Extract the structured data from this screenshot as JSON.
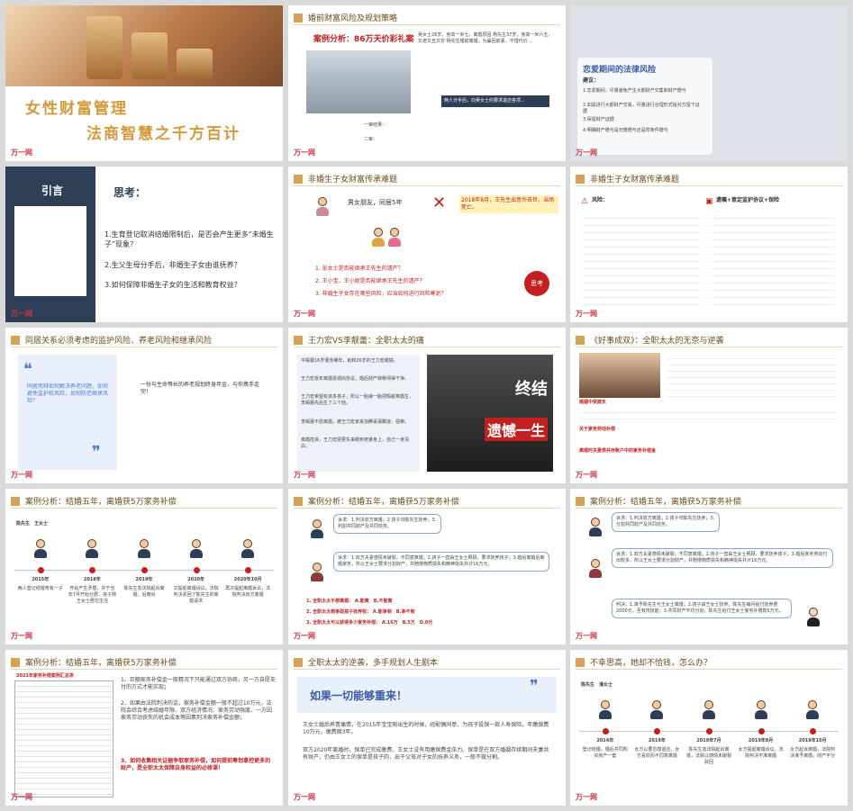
{
  "slides": {
    "s1": {
      "title_line1": "女性财富管理",
      "title_line2": "法商智慧之千方百计",
      "logo": "万一网"
    },
    "s2": {
      "header": "婚前财富风险及规划策略",
      "case_title": "案例分析：86万天价彩礼案",
      "text": "吴女士26岁，身高一米七，离婚原因 杨先生37岁，身高一米六五，又老又丑又穷 杨先生婚前离婚，为赢回前妻，不惜代价…",
      "panel": "两人分手后，向吴女士的要求退还各项…",
      "footer1": "一审结果：",
      "footer2": "二审：",
      "logo": "万一网"
    },
    "s3": {
      "title": "恋爱期间的法律风险",
      "lead": "建议：",
      "item1": "1.恋爱期间，尽量避免产生大额财产交集和财产赠与",
      "item2": "2.如需进行大额财产交易，尽量进行合理形式给对方留下证据",
      "item3": "3.保留财产证据",
      "item4": "4.明确财产赠与是无偿赠与还是附条件赠与",
      "logo": "万一网"
    },
    "s4": {
      "left_title": "引言",
      "right_title": "思考：",
      "q1": "1.生育登记取消结婚限制后，是否会产生更多“未婚生子”现象？",
      "q2": "2.生父生母分手后，非婚生子女由谁抚养？",
      "q3": "3.如何保障非婚生子女的生活和教育权益？",
      "logo": "万一网"
    },
    "s5": {
      "header": "非婚生子女财富传承难题",
      "relation": "男女朋友，同居5年",
      "note": "2018年8月，王先生出意外去世，当场死亡。",
      "q1": "1. 张女士是否能继承王先生的遗产？",
      "q2": "2. 王小宝、王小妮是否能继承王先生的遗产？",
      "q3": "3. 非婚生子女存在哪些风险，应当如何进行风险筹划？",
      "think": "思考",
      "logo": "万一网"
    },
    "s6": {
      "header": "非婚生子女财富传承难题",
      "left_title": "风险：",
      "right_title": "遗嘱+意定监护协议+保险",
      "logo": "万一网"
    },
    "s7": {
      "header": "同居关系必须考虑的监护风险、养老风险和继承风险",
      "left_text": "同居而辩如何解决养老问题，如何避免监护权风险，如何防范继承风险？",
      "right_text": "一份与生命等长的养老规划终身年金，与你携手走完！",
      "logo": "万一网"
    },
    "s8": {
      "header": "王力宏VS李靓蕾：全职太太的痛",
      "b1": "平殿蕾16岁便赤裸年，就和26岁的王力宏眼镜。",
      "b2": "王力宏逐年离婚逐城尚协议，婚后财产转移师得干净。",
      "b3": "王力宏希望有孩多孩子，所以一胎接一胎把瑕疵离婚生，李殿蕾先后生了三个娃。",
      "b4": "李殿蕾不愿离婚，被王力宏家来加腾毒语霸凌，强窜。",
      "b5": "离婚控诉，王力宏把更东来眼到老婆身上，自己一身清白。",
      "poster1": "终结",
      "poster2": "遗憾一生",
      "logo": "万一网"
    },
    "s9": {
      "header": "《好事成双》：全职太太的无奈与逆袭",
      "section1": "婚姻中受欺负",
      "section2": "关于家务劳动补偿",
      "section3": "离婚时夫妻债共存账户中的家务补偿金",
      "logo": "万一网"
    },
    "s10": {
      "header": "案例分析：结婚五年，离婚获5万家务补偿",
      "names": "陈先生　王女士",
      "years": [
        "2015年",
        "2018年",
        "2019年",
        "2020年",
        "2020年10月"
      ],
      "events": [
        "两人登记结婚育有一子",
        "开始产生矛盾，并于当年7月开始分居，孩子随王女士居住生活",
        "陈先生向法院起诉离婚，后撤诉",
        "又提起离婚诉讼，法院判决驳回了陈先生的离婚请求",
        "再次提起离婚诉讼，法院判决双方离婚"
      ],
      "logo": "万一网"
    },
    "s11": {
      "header": "案例分析：结婚五年，离婚获5万家务补偿",
      "plea1": "诉求：1.判决双方离婚；2.孩子归陈先生抚养；3.判割共同财产及共同债务。",
      "plea2": "诉求：1.双方夫妻感情未破裂，不同意离婚；2.孩子一直由王女士照顾，要求抚养孩子；3.婚后离婚后离婚家务，所以王女士要求分割财产，并赔偿物质损失和精神损失共计16万元。",
      "a1": "1. 全职太太不想离婚：",
      "a1_opts": "A.能离　B.不能离",
      "a2": "2. 全职太太想争取孩子抚养权：",
      "a2_opts": "A.能争到　B.争不到",
      "a3": "3. 全职太太可以获得多少家务补偿：",
      "a3_opts": "A.16万　B.5万　D.0元",
      "logo": "万一网"
    },
    "s12": {
      "header": "案例分析：结婚五年，离婚获5万家务补偿",
      "plea1": "诉求：1.判决双方离婚；2.孩子归陈先生抚养；3.分割共同财产及共同债务。",
      "plea2": "诉求：1.双方夫妻感情未破裂，不同意离婚；2.孩子一直由王女士照顾，要求抚养孩子；3.婚后家务劳动付出较多，所以王女士要求分割财产，并赔偿物质损失和精神损失共计16万元。",
      "verdict": "判决：1.准予陈先生与王女士离婚；2.孩子由王女士抚养，陈先生每月给付抚养费2000元，至有抚抚能；3.共同财产平均分割，陈先生给付王女士家务补偿款5万元。",
      "logo": "万一网"
    },
    "s13": {
      "header": "案例分析：结婚五年，离婚获5万家务补偿",
      "table_title": "2021年家务补偿案例汇总表",
      "p1": "1、巨额家务补偿金一般精况下只能通过双方协商，另一方自愿支付的方式才能实现；",
      "p2": "2、如果由法院判决的话，家务补偿金额一般不超过10万元，法院会综合考虑结婚年限、双方经济情况、家务劳动强度、一方因家务劳动丧失的机会成本等因素判决家务补偿金额；",
      "p3": "3、如何收集相关证据争取家务补偿，如何提前筹划拿控更多的财产，是全职太太保障自身权益的必修课！",
      "logo": "万一网"
    },
    "s14": {
      "header": "全职太太的逆袭，多手规划人生剧本",
      "slogan": "如果一切能够重来！",
      "p1": "王女士婚后养青痛情，在2015年宝宝刚出生的时候，经配偶同意，为孩子投保一款人寿保险，年缴保费10万元，缴费期3年。",
      "p2": "双方2020年离婚时，保单已完成缴费，王女士没有用缴保费金压力。保单是在双方婚姻存续期间夫妻共有财产，仍由王女士的保单是孩子的，出于父母对于女的抚养义务，一般不做分割。",
      "logo": "万一网"
    },
    "s15": {
      "header": "不幸思高，她却不恰钱，怎么办？",
      "names": "陈先生　潘女士",
      "years": [
        "2014年",
        "2019年",
        "2019年7月",
        "2019年8月",
        "2019年10月"
      ],
      "events": [
        "登记结婚，婚后共同购买房产一套",
        "女方以要息感退还，女方喜欢而不同意离婚",
        "陈先生向法院起诉离婚，法院以感情未破裂驳回",
        "女方提起离婚诉讼，法院判决不准离婚",
        "女方起诉离婚，法院判决准予离婚，财产平分"
      ],
      "logo": "万一网"
    }
  },
  "colors": {
    "accent": "#c41f1f",
    "gold": "#d6a25a",
    "navy": "#2f3e57",
    "blue": "#4a7bd0"
  }
}
